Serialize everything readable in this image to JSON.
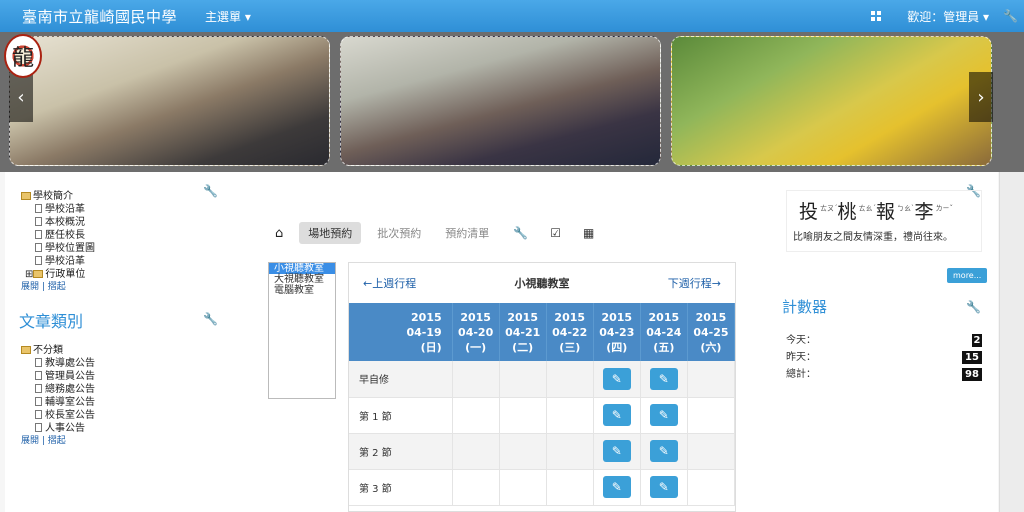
{
  "header": {
    "site_title": "臺南市立龍崎國民中學",
    "main_menu": "主選單 ▾",
    "welcome": "歡迎：管理員 ▾"
  },
  "banner": {
    "prev": "‹",
    "next": "›",
    "logo_text": "龍"
  },
  "left": {
    "tree1": {
      "root": "學校簡介",
      "items": [
        "學校沿革",
        "本校概況",
        "歷任校長",
        "學校位置圖",
        "學校沿革"
      ],
      "folder": "行政單位",
      "expand": "展開",
      "collapse": "摺起"
    },
    "section2_title": "文章類別",
    "tree2": {
      "root": "不分類",
      "items": [
        "教導處公告",
        "管理員公告",
        "總務處公告",
        "輔導室公告",
        "校長室公告",
        "人事公告"
      ],
      "expand": "展開",
      "collapse": "摺起"
    }
  },
  "toolbar": {
    "tab_active": "場地預約",
    "tab2": "批次預約",
    "tab3": "預約清單"
  },
  "rooms": [
    "小視聽教室",
    "大視聽教室",
    "電腦教室"
  ],
  "schedule": {
    "prev": "←上週行程",
    "title": "小視聽教室",
    "next": "下週行程→",
    "days": [
      {
        "y": "2015",
        "d": "04-19",
        "w": "(日)"
      },
      {
        "y": "2015",
        "d": "04-20",
        "w": "(一)"
      },
      {
        "y": "2015",
        "d": "04-21",
        "w": "(二)"
      },
      {
        "y": "2015",
        "d": "04-22",
        "w": "(三)"
      },
      {
        "y": "2015",
        "d": "04-23",
        "w": "(四)"
      },
      {
        "y": "2015",
        "d": "04-24",
        "w": "(五)"
      },
      {
        "y": "2015",
        "d": "04-25",
        "w": "(六)"
      }
    ],
    "periods": [
      "早自修",
      "第 1 節",
      "第 2 節",
      "第 3 節"
    ]
  },
  "right": {
    "motto_chars": [
      "投",
      "桃",
      "報",
      "李"
    ],
    "motto_zhuyin": [
      "ㄊㄡˊ",
      "ㄊㄠˊ",
      "ㄅㄠˋ",
      "ㄌㄧˇ"
    ],
    "motto_text": "比喻朋友之間友情深重，禮尚往來。",
    "more": "more...",
    "counter_title": "計數器",
    "today_label": "今天：",
    "today": "2",
    "yesterday_label": "昨天：",
    "yesterday": "15",
    "total_label": "總計：",
    "total": "98"
  },
  "colors": {
    "accent": "#2f8fd6",
    "header_cell": "#4a8ac6",
    "edit_button": "#3ba0d8"
  }
}
